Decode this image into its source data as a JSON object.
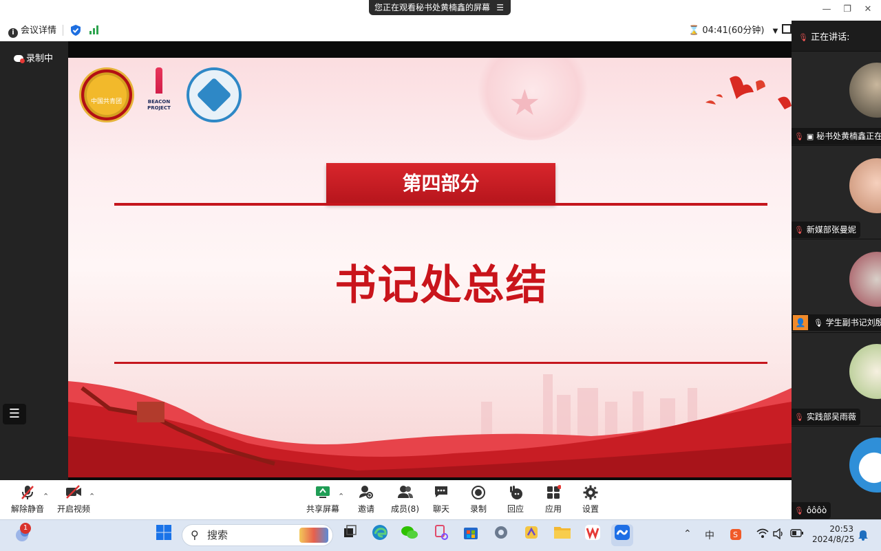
{
  "window": {
    "banner_text": "您正在观看秘书处黄楠鑫的屏幕",
    "banner_menu_icon": "menu-icon",
    "min_icon": "—",
    "restore_icon": "❐",
    "close_icon": "✕"
  },
  "infobar": {
    "meeting_info": "会议详情",
    "timer": "04:41(60分钟)"
  },
  "left": {
    "recording": "录制中"
  },
  "slide": {
    "section_label": "第四部分",
    "main_title": "书记处总结",
    "logo2_text": "BEACON\nPROJECT",
    "logo1_text": "中国共青团"
  },
  "participants": {
    "speaking_label": "正在讲话:",
    "list": [
      {
        "name": "秘书处黄楠鑫正在"
      },
      {
        "name": "新媒部张曼妮"
      },
      {
        "name": "学生副书记刘殷"
      },
      {
        "name": "实践部吴雨薇"
      },
      {
        "name": "ôôôò"
      }
    ]
  },
  "toolbar": {
    "unmute": "解除静音",
    "start_video": "开启视频",
    "share_screen": "共享屏幕",
    "invite": "邀请",
    "members": "成员(8)",
    "chat": "聊天",
    "record": "录制",
    "reactions": "回应",
    "apps": "应用",
    "settings": "设置"
  },
  "taskbar": {
    "search_placeholder": "搜索",
    "notification_count": "1",
    "time": "20:53",
    "date": "2024/8/25",
    "ime": "中"
  },
  "colors": {
    "accent_red": "#c5161d",
    "dark_panel": "#1c1c1c",
    "taskbar_bg": "#dde6f3"
  }
}
